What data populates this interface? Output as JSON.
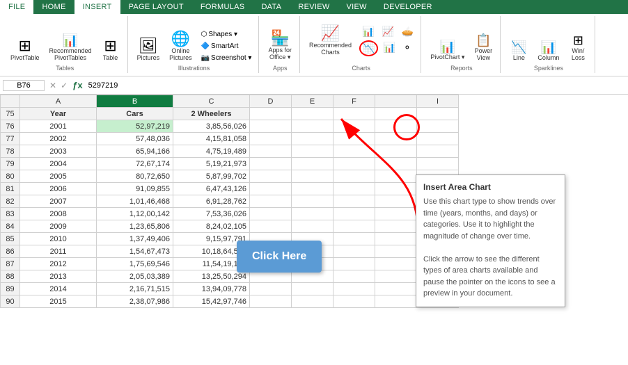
{
  "tabs": [
    {
      "label": "FILE",
      "active": false
    },
    {
      "label": "HOME",
      "active": false
    },
    {
      "label": "INSERT",
      "active": true
    },
    {
      "label": "PAGE LAYOUT",
      "active": false
    },
    {
      "label": "FORMULAS",
      "active": false
    },
    {
      "label": "DATA",
      "active": false
    },
    {
      "label": "REVIEW",
      "active": false
    },
    {
      "label": "VIEW",
      "active": false
    },
    {
      "label": "DEVELOPER",
      "active": false
    }
  ],
  "ribbon_groups": [
    {
      "name": "Tables",
      "items": [
        "PivotTable",
        "Recommended\nPivotTables",
        "Table"
      ]
    },
    {
      "name": "Illustrations",
      "items": [
        "Pictures",
        "Online\nPictures",
        "Shapes -",
        "SmartArt",
        "Screenshot -"
      ]
    },
    {
      "name": "Apps",
      "items": [
        "Apps for\nOffice -"
      ]
    },
    {
      "name": "Charts",
      "items": [
        "Recommended\nCharts"
      ]
    },
    {
      "name": "Reports",
      "items": [
        "PivotChart",
        "Power\nView"
      ]
    },
    {
      "name": "Sparklines",
      "items": [
        "Line",
        "Column",
        "Win/\nLoss"
      ]
    }
  ],
  "formula_bar": {
    "cell_ref": "B76",
    "formula": "5297219"
  },
  "col_headers": [
    "",
    "A",
    "B",
    "C",
    "D",
    "E",
    "F",
    "",
    "I"
  ],
  "col_headers_labels": [
    "Year",
    "Cars",
    "2 Wheelers"
  ],
  "rows": [
    {
      "row": "75",
      "year": "Year",
      "cars": "Cars",
      "wheelers": "2 Wheelers"
    },
    {
      "row": "76",
      "year": "2001",
      "cars": "52,97,219",
      "wheelers": "3,85,56,026"
    },
    {
      "row": "77",
      "year": "2002",
      "cars": "57,48,036",
      "wheelers": "4,15,81,058"
    },
    {
      "row": "78",
      "year": "2003",
      "cars": "65,94,166",
      "wheelers": "4,75,19,489"
    },
    {
      "row": "79",
      "year": "2004",
      "cars": "72,67,174",
      "wheelers": "5,19,21,973"
    },
    {
      "row": "80",
      "year": "2005",
      "cars": "80,72,650",
      "wheelers": "5,87,99,702"
    },
    {
      "row": "81",
      "year": "2006",
      "cars": "91,09,855",
      "wheelers": "6,47,43,126"
    },
    {
      "row": "82",
      "year": "2007",
      "cars": "1,01,46,468",
      "wheelers": "6,91,28,762"
    },
    {
      "row": "83",
      "year": "2008",
      "cars": "1,12,00,142",
      "wheelers": "7,53,36,026"
    },
    {
      "row": "84",
      "year": "2009",
      "cars": "1,23,65,806",
      "wheelers": "8,24,02,105"
    },
    {
      "row": "85",
      "year": "2010",
      "cars": "1,37,49,406",
      "wheelers": "9,15,97,791"
    },
    {
      "row": "86",
      "year": "2011",
      "cars": "1,54,67,473",
      "wheelers": "10,18,64,582"
    },
    {
      "row": "87",
      "year": "2012",
      "cars": "1,75,69,546",
      "wheelers": "11,54,19,175"
    },
    {
      "row": "88",
      "year": "2013",
      "cars": "2,05,03,389",
      "wheelers": "13,25,50,294"
    },
    {
      "row": "89",
      "year": "2014",
      "cars": "2,16,71,515",
      "wheelers": "13,94,09,778"
    },
    {
      "row": "90",
      "year": "2015",
      "cars": "2,38,07,986",
      "wheelers": "15,42,97,746"
    }
  ],
  "tooltip": {
    "title": "Insert Area Chart",
    "text": "Use this chart type to show trends over time (years, months, and days) or categories. Use it to highlight the magnitude of change over time.\n\nClick the arrow to see the different types of area charts available and pause the pointer on the icons to see a preview in your document."
  },
  "click_here_label": "Click Here"
}
